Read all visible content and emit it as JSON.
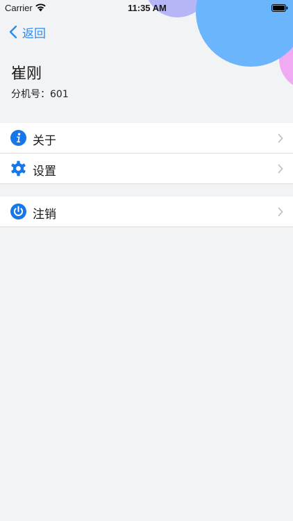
{
  "status_bar": {
    "carrier": "Carrier",
    "time": "11:35 AM"
  },
  "nav": {
    "back_label": "返回"
  },
  "profile": {
    "name": "崔刚",
    "extension_label": "分机号：",
    "extension_value": "601"
  },
  "menu": {
    "group1": [
      {
        "label": "关于",
        "icon": "info-icon"
      },
      {
        "label": "设置",
        "icon": "gear-icon"
      }
    ],
    "group2": [
      {
        "label": "注销",
        "icon": "power-icon"
      }
    ]
  },
  "colors": {
    "accent": "#2a8bf2",
    "icon_blue": "#1677e8",
    "background": "#f2f3f5",
    "bubble_blue": "#6ab5fb",
    "bubble_purple": "#b6b5f5",
    "bubble_pink": "#f0a9f3"
  }
}
